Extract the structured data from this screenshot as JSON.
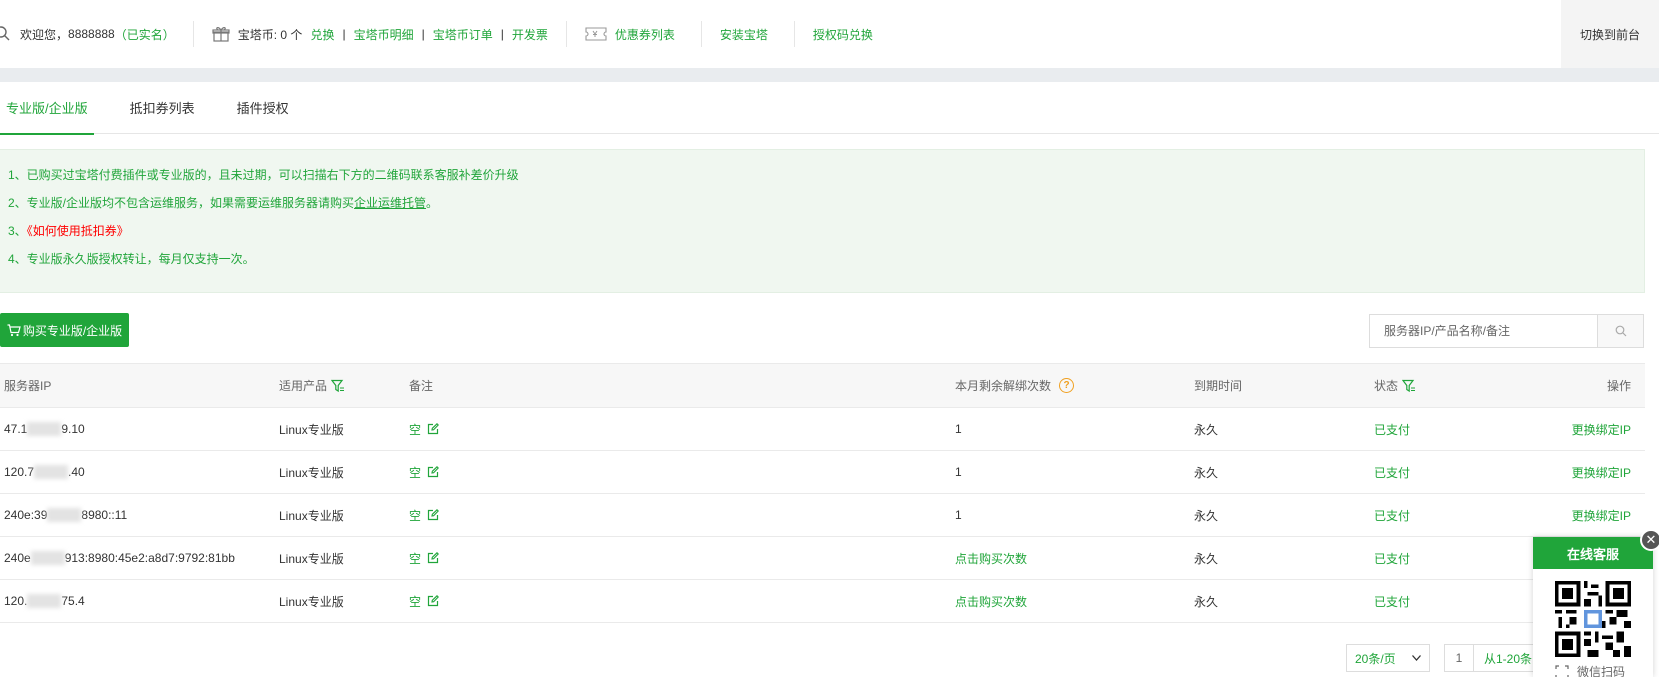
{
  "topbar": {
    "welcome_prefix": "欢迎您，",
    "username": "8888888",
    "verified": "（已实名）",
    "coins_label": "宝塔币: 0 个",
    "exchange": "兑换",
    "sep": "|",
    "coin_detail": "宝塔币明细",
    "coin_orders": "宝塔币订单",
    "invoice": "开发票",
    "coupons": "优惠券列表",
    "install": "安装宝塔",
    "auth_code": "授权码兑换",
    "switch_front": "切换到前台"
  },
  "tabs": [
    {
      "label": "专业版/企业版",
      "active": true
    },
    {
      "label": "抵扣券列表",
      "active": false
    },
    {
      "label": "插件授权",
      "active": false
    }
  ],
  "notice": {
    "line1": "1、已购买过宝塔付费插件或专业版的，且未过期，可以扫描右下方的二维码联系客服补差价升级",
    "line2_prefix": "2、专业版/企业版均不包含运维服务，如果需要运维服务器请购买",
    "line2_link": "企业运维托管",
    "line2_suffix": "。",
    "line3_prefix": "3、",
    "line3_link": "《如何使用抵扣券》",
    "line4": "4、专业版永久版授权转让，每月仅支持一次。"
  },
  "toolbar": {
    "buy_label": "购买专业版/企业版",
    "search_placeholder": "服务器IP/产品名称/备注"
  },
  "table": {
    "headers": {
      "ip": "服务器IP",
      "product": "适用产品",
      "remark": "备注",
      "unbind": "本月剩余解绑次数",
      "expire": "到期时间",
      "status": "状态",
      "action": "操作"
    },
    "rows": [
      {
        "ip_a": "47.1",
        "ip_b": "9.10",
        "product": "Linux专业版",
        "remark": "空",
        "unbind": "1",
        "unbind_link": false,
        "expire": "永久",
        "status": "已支付",
        "action": "更换绑定IP"
      },
      {
        "ip_a": "120.7",
        "ip_b": ".40",
        "product": "Linux专业版",
        "remark": "空",
        "unbind": "1",
        "unbind_link": false,
        "expire": "永久",
        "status": "已支付",
        "action": "更换绑定IP"
      },
      {
        "ip_a": "240e:39",
        "ip_b": "8980::11",
        "product": "Linux专业版",
        "remark": "空",
        "unbind": "1",
        "unbind_link": false,
        "expire": "永久",
        "status": "已支付",
        "action": "更换绑定IP"
      },
      {
        "ip_a": "240e",
        "ip_b": "913:8980:45e2:a8d7:9792:81bb",
        "product": "Linux专业版",
        "remark": "空",
        "unbind": "点击购买次数",
        "unbind_link": true,
        "expire": "永久",
        "status": "已支付",
        "action": ""
      },
      {
        "ip_a": "120.",
        "ip_b": "75.4",
        "product": "Linux专业版",
        "remark": "空",
        "unbind": "点击购买次数",
        "unbind_link": true,
        "expire": "永久",
        "status": "已支付",
        "action": ""
      }
    ]
  },
  "pagination": {
    "page_size": "20条/页",
    "current_page": "1",
    "info": "从1-20条"
  },
  "service": {
    "title": "在线客服",
    "footer": "微信扫码",
    "close": "✕"
  },
  "colors": {
    "accent": "#20a53a",
    "link_red": "#ff0000",
    "help": "#f0a020"
  }
}
